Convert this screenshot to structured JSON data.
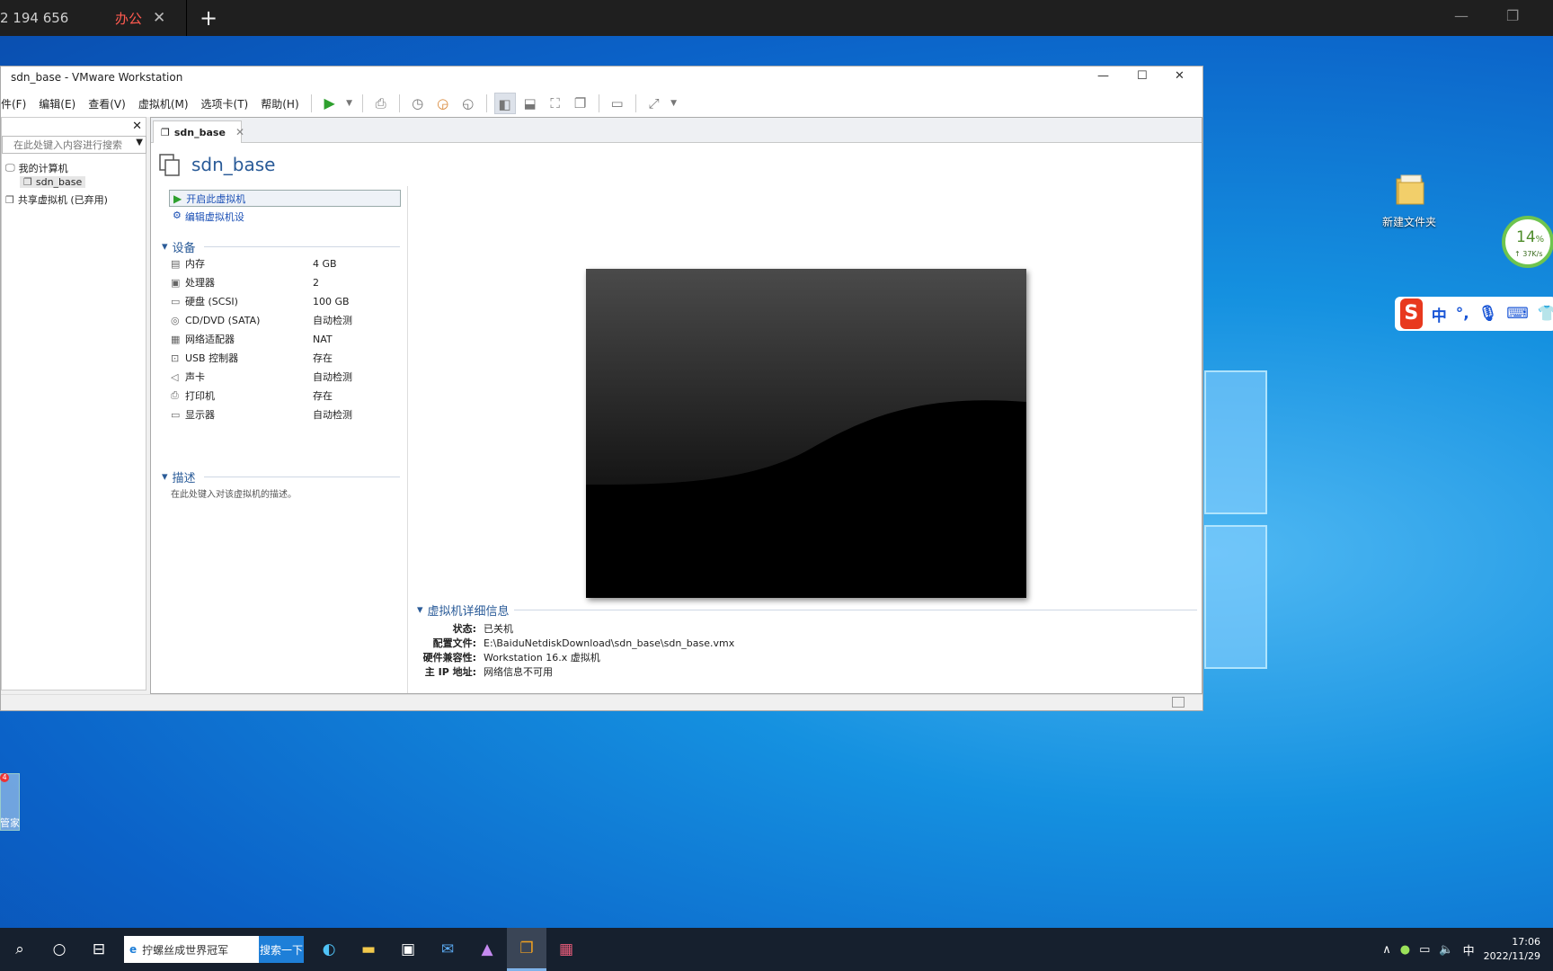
{
  "remote_bar": {
    "tab1": "2 194 656",
    "tab2": "办公",
    "close_glyph": "✕",
    "new_tab_glyph": "+",
    "minimize_glyph": "—",
    "restore_glyph": "❐",
    "dropdown_glyph": "⌄"
  },
  "window": {
    "title": "sdn_base - VMware Workstation",
    "controls": {
      "minimize": "—",
      "maximize": "☐",
      "close": "✕"
    }
  },
  "menu": [
    "件(F)",
    "编辑(E)",
    "查看(V)",
    "虚拟机(M)",
    "选项卡(T)",
    "帮助(H)"
  ],
  "library": {
    "close": "✕",
    "search_placeholder": "在此处键入内容进行搜索",
    "tree": {
      "root": "我的计算机",
      "vm": "sdn_base",
      "shared": "共享虚拟机 (已弃用)"
    }
  },
  "tab": {
    "label": "sdn_base",
    "close": "✕"
  },
  "vm": {
    "title": "sdn_base",
    "actions": {
      "start": "开启此虚拟机",
      "edit": "编辑虚拟机设"
    },
    "devices_header": "设备",
    "devices": [
      {
        "icon": "memory-icon",
        "glyph": "▤",
        "name": "内存",
        "value": "4 GB"
      },
      {
        "icon": "processor-icon",
        "glyph": "▣",
        "name": "处理器",
        "value": "2"
      },
      {
        "icon": "harddisk-icon",
        "glyph": "▭",
        "name": "硬盘 (SCSI)",
        "value": "100 GB"
      },
      {
        "icon": "cdrom-icon",
        "glyph": "◎",
        "name": "CD/DVD (SATA)",
        "value": "自动检测"
      },
      {
        "icon": "network-icon",
        "glyph": "▦",
        "name": "网络适配器",
        "value": "NAT"
      },
      {
        "icon": "usb-icon",
        "glyph": "⊡",
        "name": "USB 控制器",
        "value": "存在"
      },
      {
        "icon": "sound-icon",
        "glyph": "◁",
        "name": "声卡",
        "value": "自动检测"
      },
      {
        "icon": "printer-icon",
        "glyph": "⎙",
        "name": "打印机",
        "value": "存在"
      },
      {
        "icon": "display-icon",
        "glyph": "▭",
        "name": "显示器",
        "value": "自动检测"
      }
    ],
    "description_header": "描述",
    "description_placeholder": "在此处键入对该虚拟机的描述。",
    "details": {
      "header": "虚拟机详细信息",
      "rows": [
        {
          "key": "状态:",
          "value": "已关机"
        },
        {
          "key": "配置文件:",
          "value": "E:\\BaiduNetdiskDownload\\sdn_base\\sdn_base.vmx"
        },
        {
          "key": "硬件兼容性:",
          "value": "Workstation 16.x 虚拟机"
        },
        {
          "key": "主 IP 地址:",
          "value": "网络信息不可用"
        }
      ]
    }
  },
  "desktop": {
    "folder_label": "新建文件夹",
    "perf_percent": "14",
    "perf_unit": "%",
    "perf_speed": "↑ 37K/s",
    "ime": {
      "logo": "S",
      "lang": "中",
      "punct": "°,",
      "mic": "🎙",
      "keyboard": "⌨",
      "shirt": "👕"
    },
    "left_icon_label": "管家",
    "left_icon_badge": "4"
  },
  "taskbar": {
    "search_text": "拧螺丝成世界冠军",
    "search_button": "搜索一下",
    "tray": {
      "ime": "中",
      "time": "17:06",
      "date": "2022/11/29",
      "chevron": "∧",
      "volume": "🔈",
      "network": "▭"
    }
  },
  "colors": {
    "accent": "#2a5b98",
    "play": "#2ea02e",
    "remote_tab_active": "#ff5a4f",
    "desktop_blue": "#0b62c8"
  }
}
